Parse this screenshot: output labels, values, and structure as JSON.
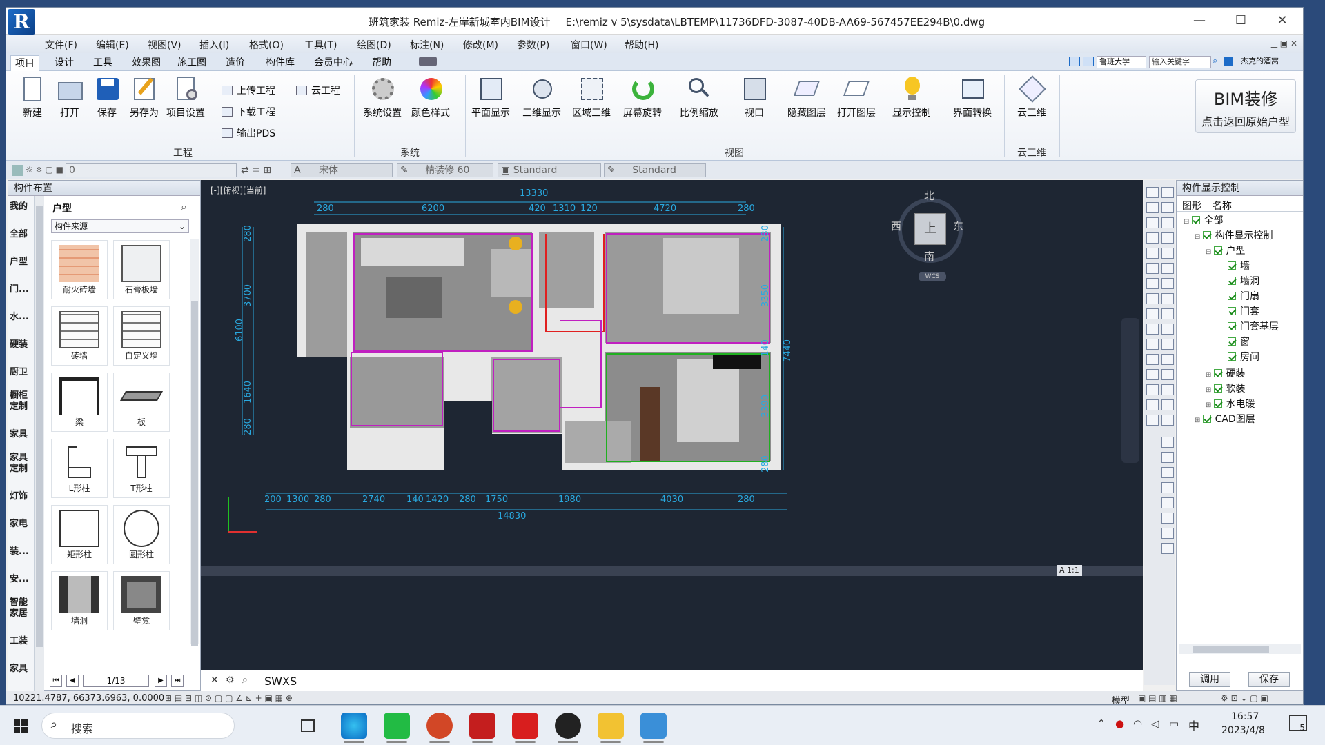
{
  "window": {
    "title": "班筑家装 Remiz-左岸新城室内BIM设计",
    "path": "E:\\remiz v 5\\sysdata\\LBTEMP\\11736DFD-3087-40DB-AA69-567457EE294B\\0.dwg",
    "logo": "R"
  },
  "menu": [
    "文件(F)",
    "编辑(E)",
    "视图(V)",
    "插入(I)",
    "格式(O)",
    "工具(T)",
    "绘图(D)",
    "标注(N)",
    "修改(M)",
    "参数(P)",
    "窗口(W)",
    "帮助(H)"
  ],
  "tabs": [
    "项目",
    "设计",
    "工具",
    "效果图",
    "施工图",
    "造价",
    "构件库",
    "会员中心",
    "帮助"
  ],
  "tabs_right": {
    "school": "鲁班大学",
    "search_placeholder": "输入关键字",
    "user": "杰克的酒窝"
  },
  "ribbon": {
    "project": {
      "new": "新建",
      "open": "打开",
      "save": "保存",
      "saveas": "另存为",
      "settings": "项目设置",
      "upload": "上传工程",
      "download": "下载工程",
      "export": "输出PDS",
      "cloud": "云工程",
      "group": "工程"
    },
    "system": {
      "sys": "系统设置",
      "color": "颜色样式",
      "group": "系统"
    },
    "view": {
      "plan": "平面显示",
      "three": "三维显示",
      "region": "区域三维",
      "rotate": "屏幕旋转",
      "scale": "比例缩放",
      "viewport": "视口",
      "hide": "隐藏图层",
      "openlayer": "打开图层",
      "display": "显示控制",
      "switch": "界面转换",
      "group": "视图"
    },
    "cloud3d": {
      "btn": "云三维",
      "group": "云三维"
    },
    "bim": {
      "line1": "BIM装修",
      "line2": "点击返回原始户型"
    }
  },
  "propbar": {
    "layer": "0",
    "font": "宋体",
    "style": "精装修 60",
    "std1": "Standard",
    "std2": "Standard"
  },
  "left_panel": {
    "title": "构件布置",
    "categories": [
      "我的",
      "全部",
      "户型",
      "门...",
      "水...",
      "硬装",
      "厨卫",
      "橱柜定制",
      "家具",
      "家具定制",
      "灯饰",
      "家电",
      "装...",
      "安...",
      "智能家居",
      "工装",
      "家具"
    ],
    "section": "户型",
    "source": "构件来源",
    "tiles": [
      "耐火砖墙",
      "石膏板墙",
      "砖墙",
      "自定义墙",
      "梁",
      "板",
      "L形柱",
      "T形柱",
      "矩形柱",
      "圆形柱",
      "墙洞",
      "壁龛"
    ],
    "page": "1/13"
  },
  "cad": {
    "label": "[-][俯视][当前]",
    "top_total": "13330",
    "top_dims": [
      "280",
      "6200",
      "420",
      "1310",
      "120",
      "4720",
      "280"
    ],
    "bottom_total": "14830",
    "bottom_dims": [
      "200",
      "1300",
      "280",
      "2740",
      "140",
      "1420",
      "280",
      "1750",
      "1980",
      "4030",
      "280"
    ],
    "left_total": "6100",
    "left_dims": [
      "280",
      "3700",
      "1640",
      "280"
    ],
    "right_total": "7440",
    "right_dims": [
      "280",
      "3350",
      "140",
      "3390",
      "280"
    ],
    "compass": {
      "n": "北",
      "s": "南",
      "e": "东",
      "w": "西",
      "center": "上",
      "wcs": "WCS"
    },
    "scale": "1:1"
  },
  "right_panel": {
    "title": "构件显示控制",
    "tabs": [
      "图形",
      "名称"
    ],
    "tree": [
      {
        "label": "全部",
        "level": 0
      },
      {
        "label": "构件显示控制",
        "level": 1
      },
      {
        "label": "户型",
        "level": 2
      },
      {
        "label": "墙",
        "level": 3
      },
      {
        "label": "墙洞",
        "level": 3
      },
      {
        "label": "门扇",
        "level": 3
      },
      {
        "label": "门套",
        "level": 3
      },
      {
        "label": "门套基层",
        "level": 3
      },
      {
        "label": "窗",
        "level": 3
      },
      {
        "label": "房间",
        "level": 3
      },
      {
        "label": "硬装",
        "level": 2
      },
      {
        "label": "软装",
        "level": 2
      },
      {
        "label": "水电暖",
        "level": 2
      },
      {
        "label": "CAD图层",
        "level": 1
      }
    ],
    "apply": "调用",
    "save": "保存"
  },
  "command": {
    "text": "SWXS"
  },
  "status": {
    "coords": "10221.4787, 66373.6963, 0.0000",
    "mode": "模型"
  },
  "taskbar": {
    "search": "搜索",
    "time": "16:57",
    "date": "2023/4/8",
    "ime": "中",
    "notify": "5"
  },
  "colors": {
    "accent": "#1d6cc8",
    "cad_bg": "#1e2633",
    "dim": "#29a9e0",
    "wall": "#e6e6e6"
  }
}
